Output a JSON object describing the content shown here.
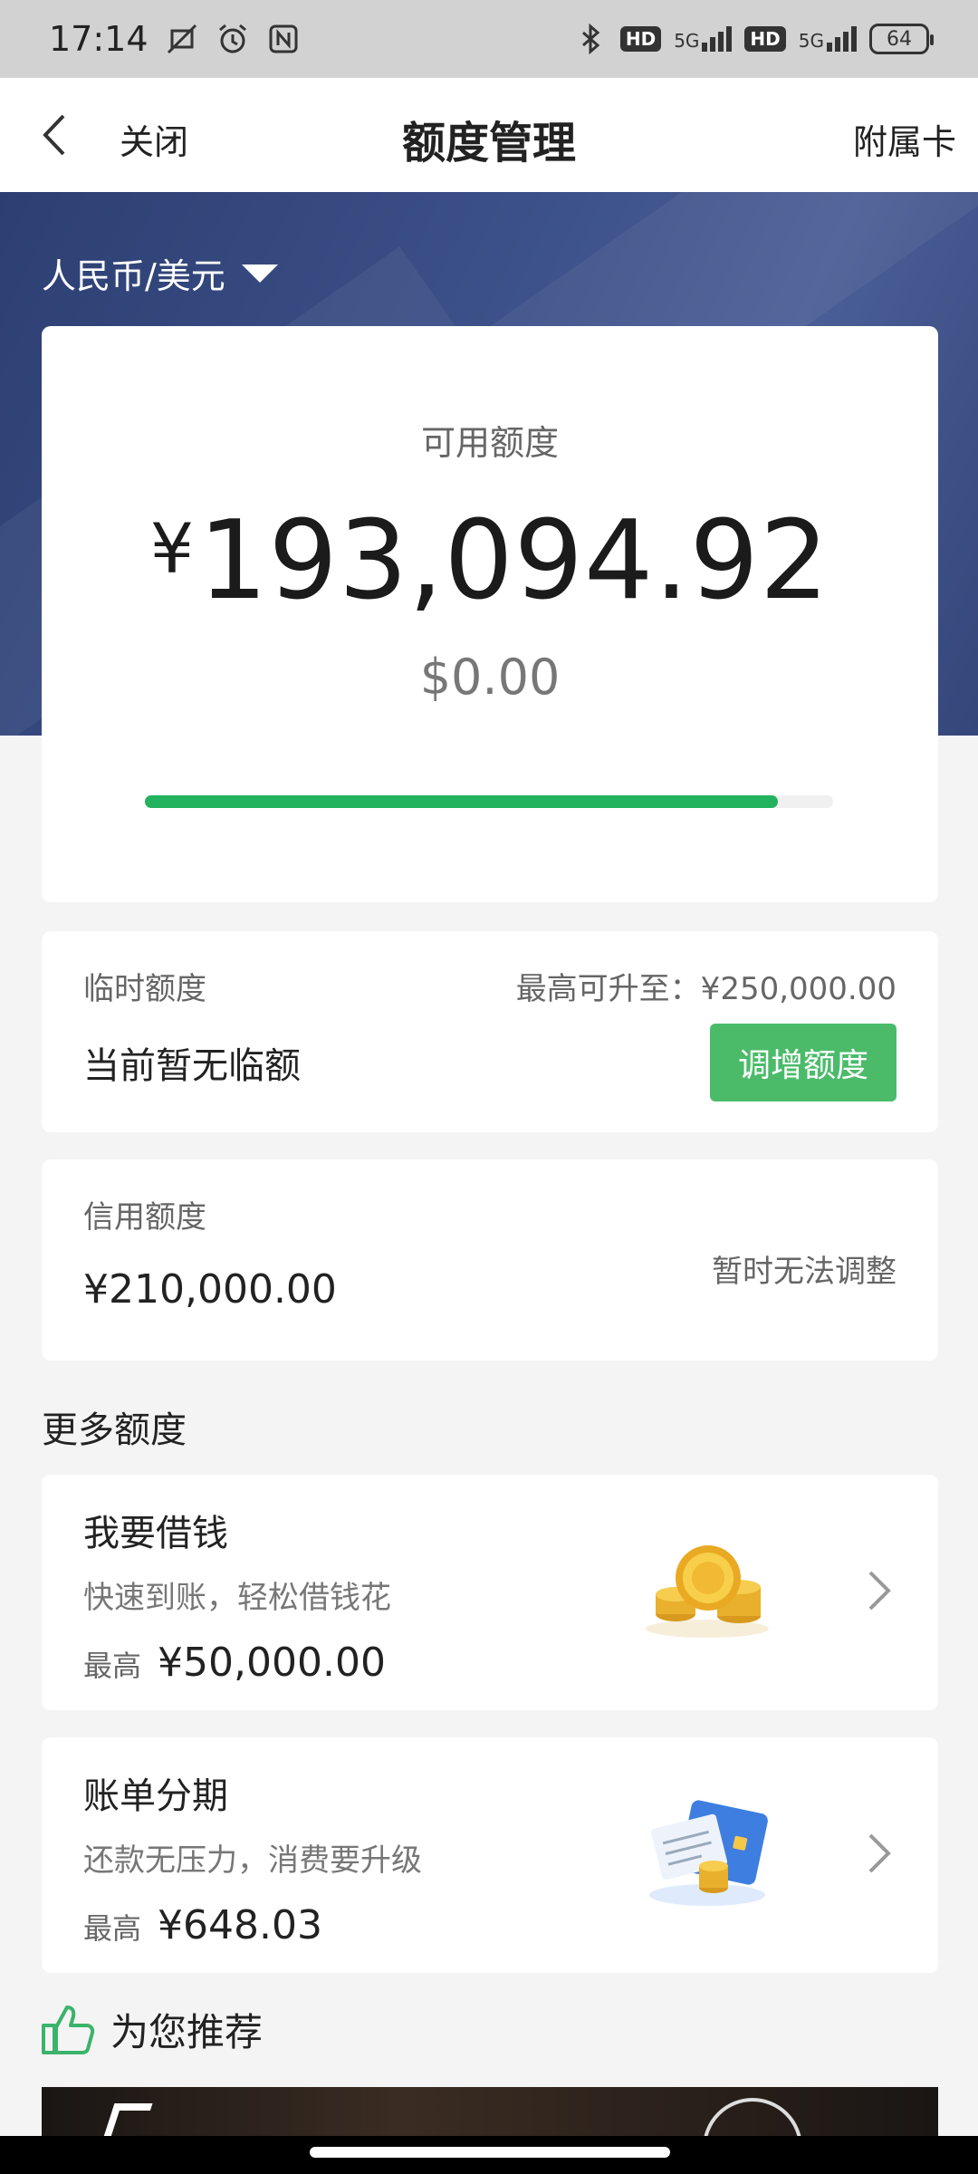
{
  "status_bar": {
    "time": "17:14",
    "network_1": "5G",
    "network_2": "5G",
    "hd_1": "HD",
    "hd_2": "HD",
    "battery": "64"
  },
  "nav": {
    "close_label": "关闭",
    "title": "额度管理",
    "right_label": "附属卡"
  },
  "currency_switch": "人民币/美元",
  "available": {
    "label": "可用额度",
    "currency_symbol": "¥",
    "cny_amount": "193,094.92",
    "usd_amount": "$0.00",
    "progress_fraction": 0.92
  },
  "temporary_limit": {
    "label": "临时额度",
    "max_up": "最高可升至：¥250,000.00",
    "status": "当前暂无临额",
    "button": "调增额度"
  },
  "credit_limit": {
    "label": "信用额度",
    "amount": "¥210,000.00",
    "note": "暂时无法调整"
  },
  "more_title": "更多额度",
  "products": [
    {
      "title": "我要借钱",
      "desc": "快速到账，轻松借钱花",
      "max_label": "最高",
      "max_value": "¥50,000.00"
    },
    {
      "title": "账单分期",
      "desc": "还款无压力，消费要升级",
      "max_label": "最高",
      "max_value": "¥648.03"
    }
  ],
  "recommend_title": "为您推荐",
  "colors": {
    "brand_green": "#4bbb6a",
    "progress_green": "#23b25e",
    "banner_blue": "#34467a"
  }
}
